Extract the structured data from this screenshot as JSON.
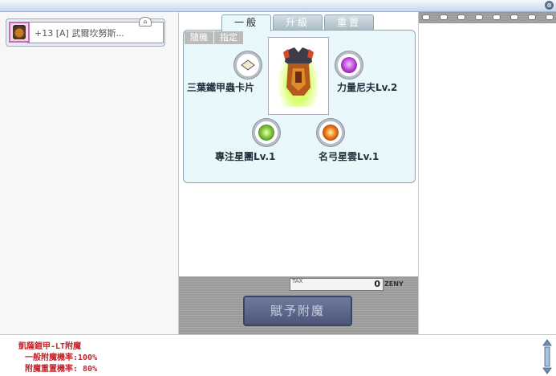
{
  "window": {
    "close_glyph": "⊗"
  },
  "item": {
    "name": "+13 [A] 武爾坎努斯...",
    "icon": "armor-icon",
    "hat_icon": "hat-icon"
  },
  "tabs": [
    {
      "label": "一般",
      "active": true
    },
    {
      "label": "升級",
      "active": false
    },
    {
      "label": "重置",
      "active": false
    }
  ],
  "subtabs": [
    {
      "label": "隨機"
    },
    {
      "label": "指定"
    }
  ],
  "slots": [
    {
      "label": "三葉鐵甲蟲卡片",
      "icon": "card-icon"
    },
    {
      "label": "力量尼夫Lv.2",
      "icon": "purple-gem-icon"
    },
    {
      "label": "專注星團Lv.1",
      "icon": "green-orb-icon"
    },
    {
      "label": "名弓星雲Lv.1",
      "icon": "orange-orb-icon"
    }
  ],
  "tax": {
    "label": "TAX",
    "value": "0",
    "currency": "ZENY"
  },
  "grant_button": {
    "label": "賦予附魔"
  },
  "info": {
    "title": "凱薩鎧甲-LT附魔",
    "line1": "一般附魔機率:100%",
    "line2": "附魔重置機率: 80%"
  },
  "colors": {
    "info_text": "#c0262c",
    "panel_bg": "#e9f8fb",
    "button_bg": "#5a6588"
  }
}
